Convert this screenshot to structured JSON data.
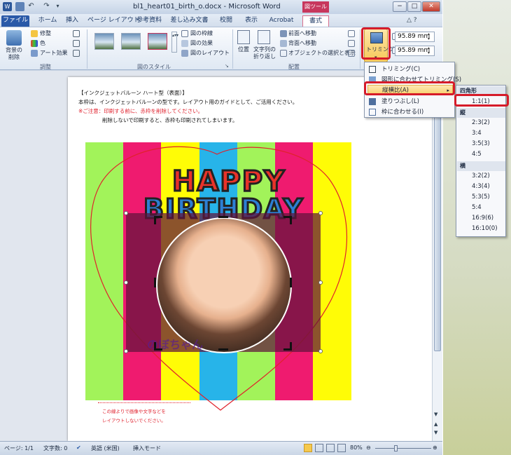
{
  "title": "bl1_heart01_birth_o.docx - Microsoft Word",
  "contextual_tab": "図ツール",
  "window_controls": [
    "−",
    "□",
    "✕"
  ],
  "tabs": [
    "ファイル",
    "ホーム",
    "挿入",
    "ページ レイアウト",
    "参考資料",
    "差し込み文書",
    "校閲",
    "表示",
    "Acrobat",
    "書式"
  ],
  "ribbon": {
    "remove_bg": "背景の\n削除",
    "correct": "修整",
    "color": "色",
    "art_effects": "アート効果",
    "group_adjust": "調整",
    "picture_border": "図の枠線",
    "picture_effects": "図の効果",
    "picture_layout": "図のレイアウト",
    "group_styles": "図のスタイル",
    "position": "位置",
    "wrap_text": "文字列の\n折り返し",
    "bring_forward": "前面へ移動",
    "send_backward": "背面へ移動",
    "selection_pane": "オブジェクトの選択と表示",
    "group_arrange": "配置",
    "crop": "トリミング",
    "height": "95.89 mm",
    "width": "95.89 mm"
  },
  "crop_menu": {
    "items": [
      "トリミング(C)",
      "図形に合わせてトリミング(S)",
      "縦横比(A)",
      "塗りつぶし(L)",
      "枠に合わせる(I)"
    ]
  },
  "ratio_submenu": {
    "square_header": "四角形",
    "square": [
      "1:1(1)"
    ],
    "portrait_header": "縦",
    "portrait": [
      "2:3(2)",
      "3:4",
      "3:5(3)",
      "4:5"
    ],
    "landscape_header": "横",
    "landscape": [
      "3:2(2)",
      "4:3(4)",
      "5:3(5)",
      "5:4",
      "16:9(6)",
      "16:10(0)"
    ]
  },
  "document": {
    "line1": "【インクジェットバルーン ハート型（表面）】",
    "line2": "本枠は、インクジェットバルーンの型です。レイアウト用のガイドとして、ご活用ください。",
    "line3": "※ご注意：印刷する前に、赤枠を削除してください。",
    "line4": "削除しないで印刷すると、赤枠も印刷されてしまいます。",
    "happy": "HAPPY",
    "birthday": "BIRTHDAY",
    "bottom_text": "のぼちゃん",
    "footer1": "この線よりで画像や文字などを",
    "footer2": "レイアウトしないでください。"
  },
  "status": {
    "page": "ページ: 1/1",
    "words": "文字数: 0",
    "language": "英語 (米国)",
    "mode": "挿入モード",
    "zoom": "80%"
  },
  "colors": {
    "stripe_green": "#a2f35a",
    "stripe_pink": "#ef1b6f",
    "stripe_yellow": "#fffc06",
    "stripe_blue": "#27b4e9",
    "highlight_red": "#d61b29"
  }
}
